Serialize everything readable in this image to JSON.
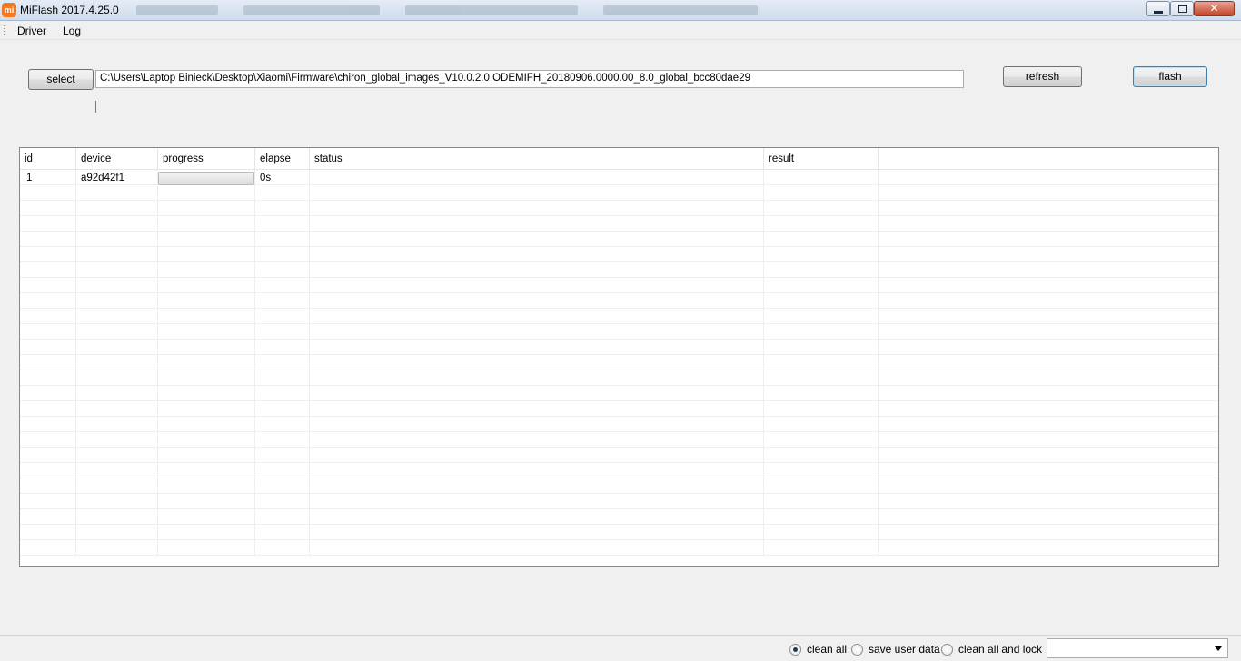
{
  "window": {
    "title": "MiFlash 2017.4.25.0",
    "icon_text": "mi",
    "controls": {
      "minimize": "minimize",
      "maximize": "maximize",
      "close": "✕"
    }
  },
  "menu": {
    "items": [
      "Driver",
      "Log"
    ]
  },
  "toolbar": {
    "select_label": "select",
    "path_value": "C:\\Users\\Laptop Binieck\\Desktop\\Xiaomi\\Firmware\\chiron_global_images_V10.0.2.0.ODEMIFH_20180906.0000.00_8.0_global_bcc80dae29",
    "refresh_label": "refresh",
    "flash_label": "flash"
  },
  "grid": {
    "columns": [
      "id",
      "device",
      "progress",
      "elapse",
      "status",
      "result"
    ],
    "rows": [
      {
        "id": "1",
        "device": "a92d42f1",
        "progress": 0,
        "elapse": "0s",
        "status": "",
        "result": ""
      }
    ]
  },
  "footer": {
    "options": [
      {
        "label": "clean all",
        "checked": true
      },
      {
        "label": "save user data",
        "checked": false
      },
      {
        "label": "clean all and lock",
        "checked": false
      }
    ],
    "dropdown_value": ""
  },
  "colors": {
    "progress_fill": "#06b025",
    "flash_border": "#3c7fb1",
    "app_icon": "#f47920"
  }
}
